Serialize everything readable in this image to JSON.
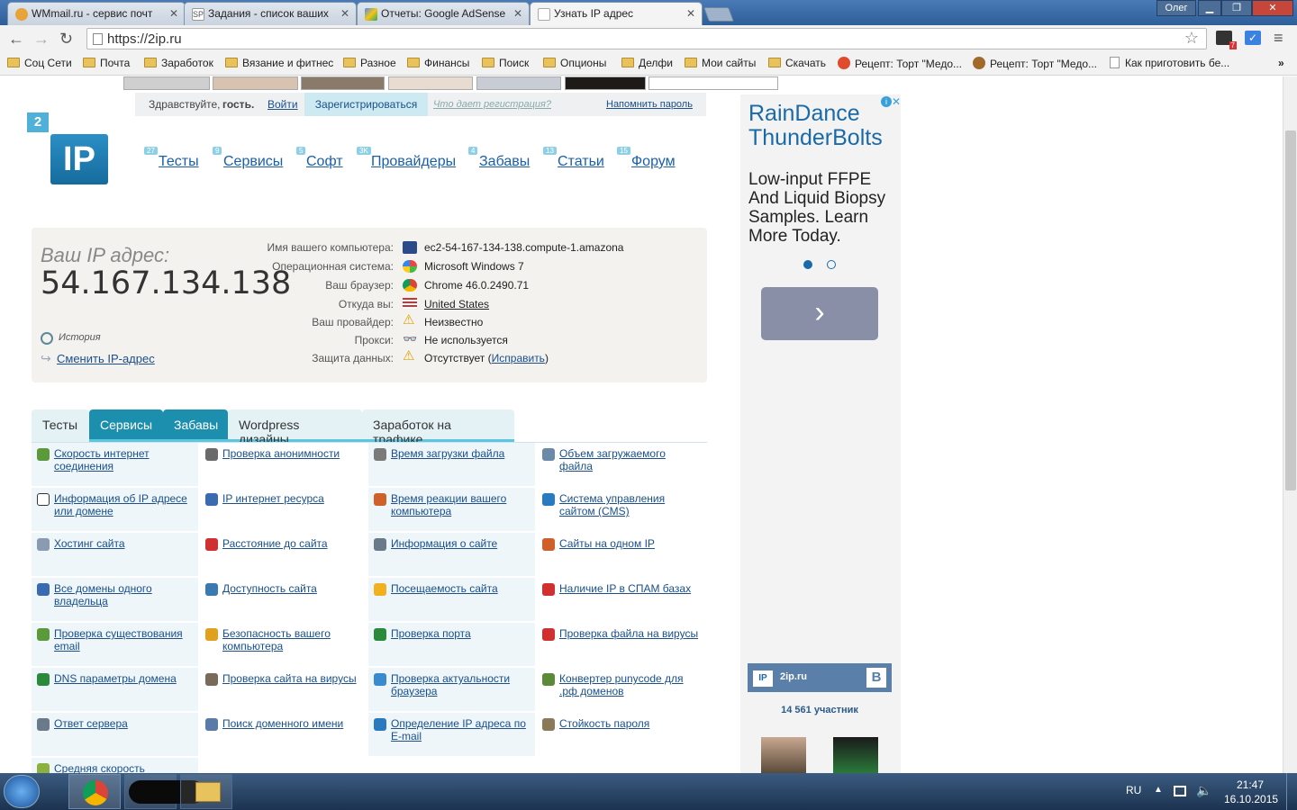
{
  "browser": {
    "tabs": [
      {
        "title": "WMmail.ru - сервис почт",
        "active": false
      },
      {
        "title": "Задания - список ваших",
        "active": false
      },
      {
        "title": "Отчеты: Google AdSense",
        "active": false
      },
      {
        "title": "Узнать IP адрес",
        "active": true
      }
    ],
    "user": "Олег",
    "url": "https://2ip.ru",
    "ext_badge": "7"
  },
  "bookmarks": [
    {
      "label": "Соц Сети",
      "icon": "folder-icon"
    },
    {
      "label": "Почта",
      "icon": "folder-icon"
    },
    {
      "label": "Заработок",
      "icon": "folder-icon"
    },
    {
      "label": "Вязание и фитнес",
      "icon": "folder-icon"
    },
    {
      "label": "Разное",
      "icon": "folder-icon"
    },
    {
      "label": "Финансы",
      "icon": "folder-icon"
    },
    {
      "label": "Поиск",
      "icon": "folder-icon"
    },
    {
      "label": "Опционы",
      "icon": "folder-icon"
    },
    {
      "label": "Делфи",
      "icon": "folder-icon"
    },
    {
      "label": "Мои сайты",
      "icon": "folder-icon"
    },
    {
      "label": "Скачать",
      "icon": "folder-icon"
    },
    {
      "label": "Рецепт: Торт \"Медо...",
      "icon": "recipe-icon"
    },
    {
      "label": "Рецепт: Торт \"Медо...",
      "icon": "recipe-icon"
    },
    {
      "label": "Как приготовить бе...",
      "icon": "page-icon"
    }
  ],
  "login": {
    "greeting": "Здравствуйте,",
    "guest": "гость.",
    "login": "Войти",
    "register": "Зарегистрироваться",
    "what": "Что дает регистрация?",
    "remind": "Напомнить пароль"
  },
  "logo": {
    "badge": "2",
    "text": "IP"
  },
  "nav": [
    {
      "label": "Тесты",
      "count": "27"
    },
    {
      "label": "Сервисы",
      "count": "9"
    },
    {
      "label": "Софт",
      "count": "5"
    },
    {
      "label": "Провайдеры",
      "count": "3K"
    },
    {
      "label": "Забавы",
      "count": "4"
    },
    {
      "label": "Статьи",
      "count": "13"
    },
    {
      "label": "Форум",
      "count": "15"
    }
  ],
  "ip": {
    "title": "Ваш IP адрес:",
    "address": "54.167.134.138",
    "history": "История",
    "change": "Сменить IP-адрес",
    "rows": [
      {
        "label": "Имя вашего компьютера:",
        "value": "ec2-54-167-134-138.compute-1.amazona",
        "icon": "computer-icon"
      },
      {
        "label": "Операционная система:",
        "value": "Microsoft Windows 7",
        "icon": "windows-icon"
      },
      {
        "label": "Ваш браузер:",
        "value": "Chrome 46.0.2490.71",
        "icon": "chrome-icon"
      },
      {
        "label": "Откуда вы:",
        "value": "United States",
        "icon": "us-flag-icon"
      },
      {
        "label": "Ваш провайдер:",
        "value": "Неизвестно",
        "icon": "warning-icon"
      },
      {
        "label": "Прокси:",
        "value": "Не используется",
        "icon": "glasses-icon"
      },
      {
        "label": "Защита данных:",
        "value": "Отсутствует (",
        "link": "Исправить",
        "tail": ")",
        "icon": "warning-icon"
      }
    ]
  },
  "section_tabs": [
    "Тесты",
    "Сервисы",
    "Забавы",
    "Wordpress дизайны",
    "Заработок на трафике"
  ],
  "services": [
    [
      "Скорость интернет соединения",
      "Проверка анонимности",
      "Время загрузки файла",
      "Объем загружаемого файла"
    ],
    [
      "Информация об IP адресе или домене",
      "IP интернет ресурса",
      "Время реакции вашего компьютера",
      "Система управления сайтом (CMS)"
    ],
    [
      "Хостинг сайта",
      "Расстояние до сайта",
      "Информация о сайте",
      "Сайты на одном IP"
    ],
    [
      "Все домены одного владельца",
      "Доступность сайта",
      "Посещаемость сайта",
      "Наличие IP в СПАМ базах"
    ],
    [
      "Проверка существования email",
      "Безопасность вашего компьютера",
      "Проверка порта",
      "Проверка файла на вирусы"
    ],
    [
      "DNS параметры домена",
      "Проверка сайта на вирусы",
      "Проверка актуальности браузера",
      "Конвертер punycode для .рф доменов"
    ],
    [
      "Ответ сервера",
      "Поиск доменного имени",
      "Определение IP адреса по E-mail",
      "Стойкость пароля"
    ],
    [
      "Средняя скорость"
    ]
  ],
  "ad": {
    "headline1": "RainDance",
    "headline2": "ThunderBolts",
    "body": "Low-input FFPE And Liquid Biopsy Samples. Learn More Today.",
    "arrow": "›"
  },
  "vk": {
    "name": "2ip.ru",
    "logo": "B",
    "members": "14 561 участник"
  },
  "taskbar": {
    "lang": "RU",
    "time": "21:47",
    "date": "16.10.2015"
  }
}
